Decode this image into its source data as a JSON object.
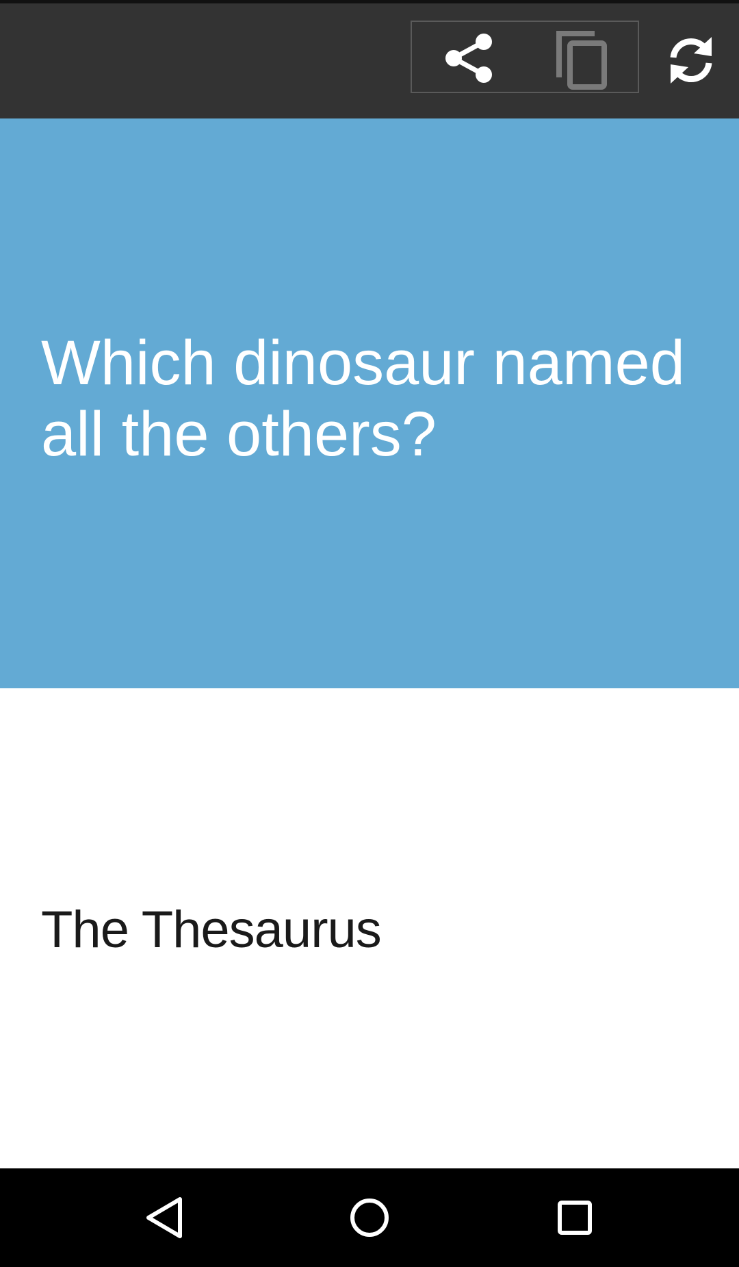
{
  "toolbar": {
    "actions": [
      {
        "icon": "share-icon"
      },
      {
        "icon": "copy-icon"
      },
      {
        "icon": "refresh-icon"
      }
    ]
  },
  "card": {
    "question": "Which dinosaur named all the others?",
    "answer": "The Thesaurus"
  },
  "colors": {
    "toolbar_bg": "#333333",
    "question_bg": "#63aad4",
    "answer_bg": "#ffffff",
    "nav_bg": "#000000"
  },
  "nav": {
    "buttons": [
      {
        "icon": "back-icon"
      },
      {
        "icon": "home-icon"
      },
      {
        "icon": "recents-icon"
      }
    ]
  }
}
